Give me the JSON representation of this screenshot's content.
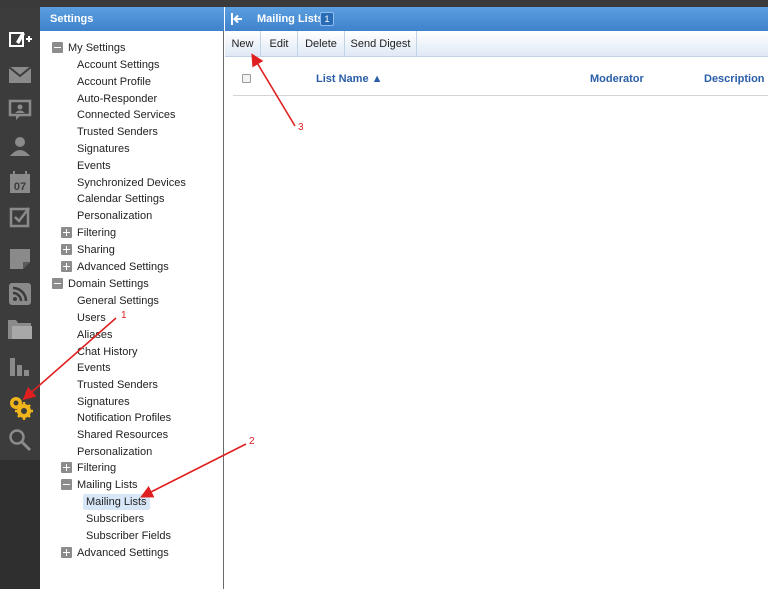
{
  "settings_panel": {
    "title": "Settings",
    "my_settings": {
      "label": "My Settings",
      "items": [
        "Account Settings",
        "Account Profile",
        "Auto-Responder",
        "Connected Services",
        "Trusted Senders",
        "Signatures",
        "Events",
        "Synchronized Devices",
        "Calendar Settings",
        "Personalization"
      ],
      "collapsed": [
        "Filtering",
        "Sharing",
        "Advanced Settings"
      ]
    },
    "domain_settings": {
      "label": "Domain Settings",
      "items": [
        "General Settings",
        "Users",
        "Aliases",
        "Chat History",
        "Events",
        "Trusted Senders",
        "Signatures",
        "Notification Profiles",
        "Shared Resources",
        "Personalization"
      ],
      "filtering": "Filtering",
      "mailing_lists": {
        "label": "Mailing Lists",
        "items": [
          "Mailing Lists",
          "Subscribers",
          "Subscriber Fields"
        ],
        "selected": "Mailing Lists"
      },
      "advanced": "Advanced Settings"
    }
  },
  "main": {
    "title": "Mailing Lists",
    "count": "1",
    "toolbar": {
      "new_label": "New",
      "edit_label": "Edit",
      "delete_label": "Delete",
      "send_digest_label": "Send Digest"
    },
    "columns": {
      "list_name": "List Name ▲",
      "moderator": "Moderator",
      "description": "Description"
    }
  },
  "rail_icons": [
    "compose-icon",
    "mail-icon",
    "chat-icon",
    "contacts-icon",
    "calendar-icon",
    "tasks-icon",
    "notes-icon",
    "rss-icon",
    "documents-icon",
    "reports-icon",
    "settings-icon",
    "search-icon"
  ],
  "calendar_day": "07",
  "annotations": [
    "1",
    "2",
    "3"
  ],
  "colors": {
    "header_blue": "#4a90d9",
    "rail_dark": "#3c3c3c",
    "link_blue": "#2a5ea8",
    "annotation_red": "#e02020",
    "settings_icon": "#f0b51a"
  }
}
